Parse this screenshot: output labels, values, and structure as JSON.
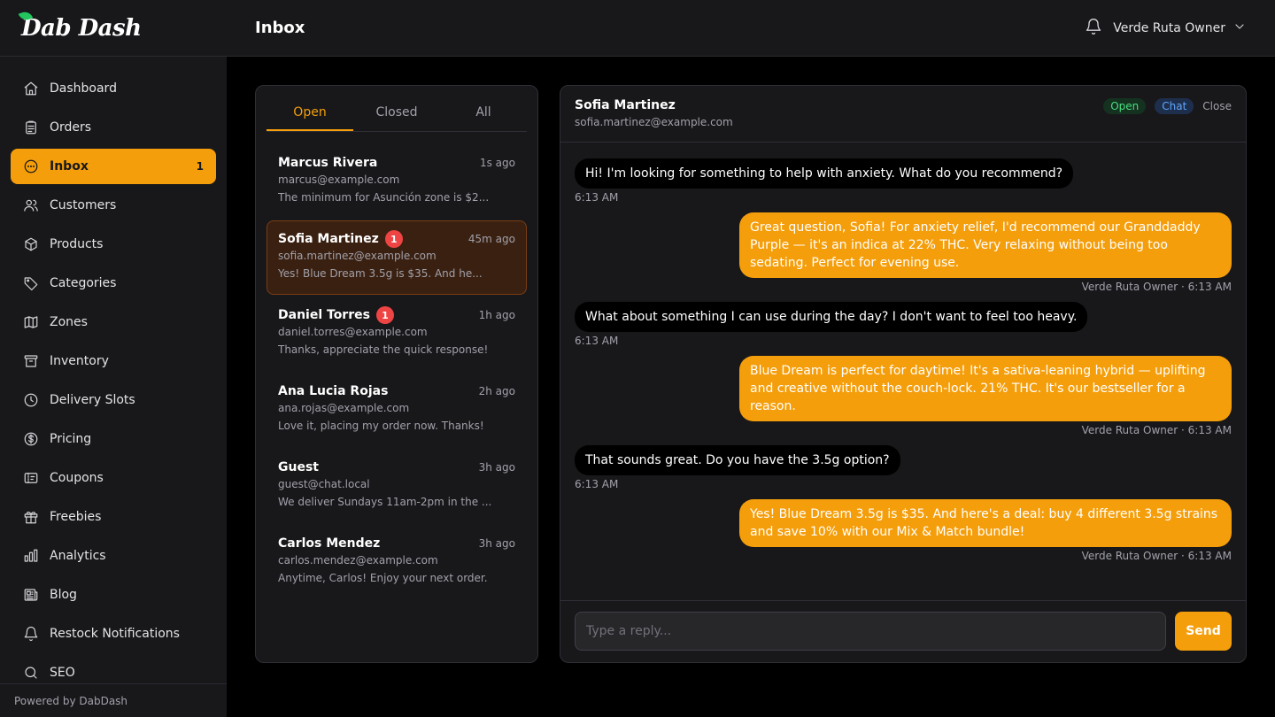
{
  "app": {
    "logo_text": "Dab Dash",
    "footer": "Powered by DabDash"
  },
  "sidebar": {
    "items": [
      {
        "label": "Dashboard",
        "icon": "home-icon"
      },
      {
        "label": "Orders",
        "icon": "clipboard-icon"
      },
      {
        "label": "Inbox",
        "icon": "chat-bubble-icon",
        "badge": "1",
        "active": true
      },
      {
        "label": "Customers",
        "icon": "users-icon"
      },
      {
        "label": "Products",
        "icon": "box-icon"
      },
      {
        "label": "Categories",
        "icon": "tag-icon"
      },
      {
        "label": "Zones",
        "icon": "map-icon"
      },
      {
        "label": "Inventory",
        "icon": "archive-icon"
      },
      {
        "label": "Delivery Slots",
        "icon": "clock-icon"
      },
      {
        "label": "Pricing",
        "icon": "dollar-icon"
      },
      {
        "label": "Coupons",
        "icon": "ticket-icon"
      },
      {
        "label": "Freebies",
        "icon": "gift-icon"
      },
      {
        "label": "Analytics",
        "icon": "bar-chart-icon"
      },
      {
        "label": "Blog",
        "icon": "newspaper-icon"
      },
      {
        "label": "Restock Notifications",
        "icon": "bell-icon"
      },
      {
        "label": "SEO",
        "icon": "search-icon"
      }
    ]
  },
  "header": {
    "title": "Inbox",
    "user": "Verde Ruta Owner"
  },
  "conversations": {
    "tabs": [
      "Open",
      "Closed",
      "All"
    ],
    "active_tab": 0,
    "items": [
      {
        "name": "Marcus Rivera",
        "email": "marcus@example.com",
        "time": "1s ago",
        "preview": "The minimum for Asunción zone is $2...",
        "unread": ""
      },
      {
        "name": "Sofia Martinez",
        "email": "sofia.martinez@example.com",
        "time": "45m ago",
        "preview": "Yes! Blue Dream 3.5g is $35. And he...",
        "unread": "1",
        "active": true
      },
      {
        "name": "Daniel Torres",
        "email": "daniel.torres@example.com",
        "time": "1h ago",
        "preview": "Thanks, appreciate the quick response!",
        "unread": "1"
      },
      {
        "name": "Ana Lucia Rojas",
        "email": "ana.rojas@example.com",
        "time": "2h ago",
        "preview": "Love it, placing my order now. Thanks!",
        "unread": ""
      },
      {
        "name": "Guest",
        "email": "guest@chat.local",
        "time": "3h ago",
        "preview": "We deliver Sundays 11am-2pm in the ...",
        "unread": ""
      },
      {
        "name": "Carlos Mendez",
        "email": "carlos.mendez@example.com",
        "time": "3h ago",
        "preview": "Anytime, Carlos! Enjoy your next order.",
        "unread": ""
      }
    ]
  },
  "chat": {
    "name": "Sofia Martinez",
    "email": "sofia.martinez@example.com",
    "status": "Open",
    "channel": "Chat",
    "close_label": "Close",
    "messages": [
      {
        "dir": "in",
        "text": "Hi! I'm looking for something to help with anxiety. What do you recommend?",
        "meta": "6:13 AM"
      },
      {
        "dir": "out",
        "text": "Great question, Sofia! For anxiety relief, I'd recommend our Granddaddy Purple — it's an indica at 22% THC. Very relaxing without being too sedating. Perfect for evening use.",
        "meta": "Verde Ruta Owner · 6:13 AM"
      },
      {
        "dir": "in",
        "text": "What about something I can use during the day? I don't want to feel too heavy.",
        "meta": "6:13 AM"
      },
      {
        "dir": "out",
        "text": "Blue Dream is perfect for daytime! It's a sativa-leaning hybrid — uplifting and creative without the couch-lock. 21% THC. It's our bestseller for a reason.",
        "meta": "Verde Ruta Owner · 6:13 AM"
      },
      {
        "dir": "in",
        "text": "That sounds great. Do you have the 3.5g option?",
        "meta": "6:13 AM"
      },
      {
        "dir": "out",
        "text": "Yes! Blue Dream 3.5g is $35. And here's a deal: buy 4 different 3.5g strains and save 10% with our Mix & Match bundle!",
        "meta": "Verde Ruta Owner · 6:13 AM"
      }
    ],
    "reply_placeholder": "Type a reply...",
    "send_label": "Send"
  },
  "colors": {
    "accent": "#f59e0b",
    "background": "#000000",
    "panel": "#18181b",
    "unread": "#ef4444"
  }
}
